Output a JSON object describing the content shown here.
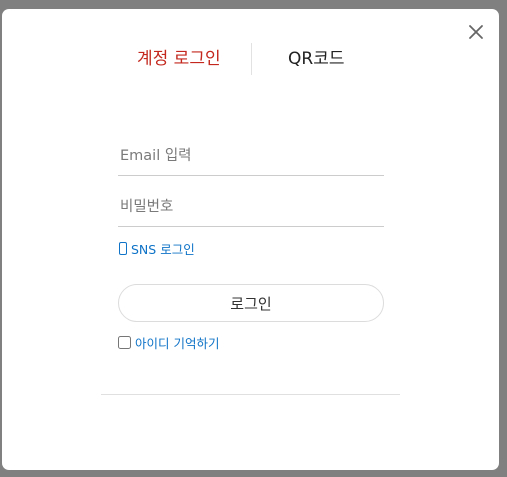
{
  "dialog": {
    "close_icon": "close-icon"
  },
  "tabs": [
    {
      "label": "계정 로그인",
      "active": true
    },
    {
      "label": "QR코드",
      "active": false
    }
  ],
  "form": {
    "email_placeholder": "Email 입력",
    "password_placeholder": "비밀번호",
    "sns_icon": "phone-icon",
    "sns_link": "SNS 로그인",
    "login_button": "로그인",
    "remember_label": "아이디 기억하기",
    "remember_checked": false
  },
  "colors": {
    "active_tab": "#c3271d",
    "link": "#0f73c7"
  }
}
